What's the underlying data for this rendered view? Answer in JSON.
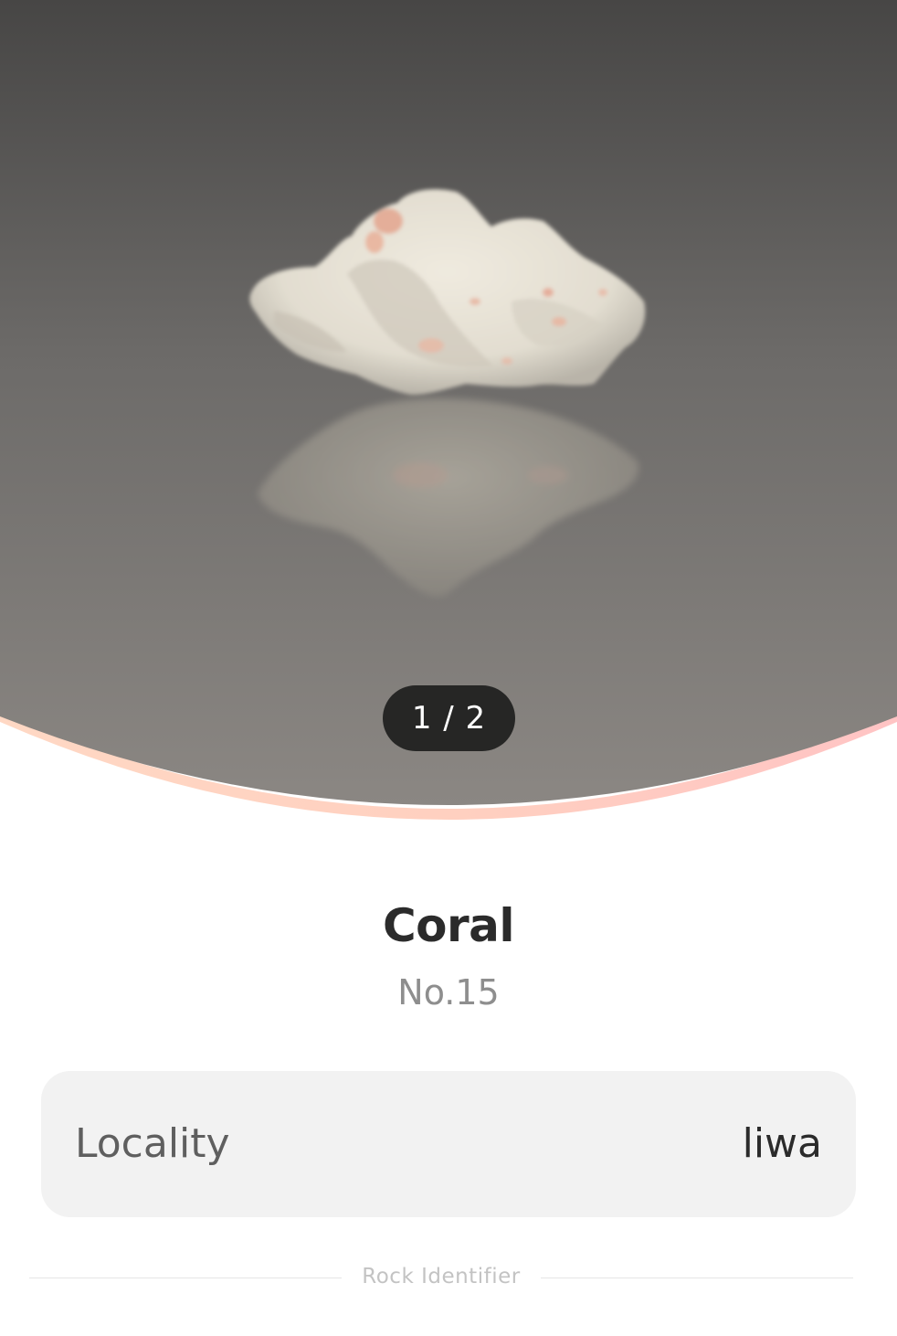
{
  "carousel": {
    "counter": "1 / 2",
    "image_subject": "coral-rock-specimen"
  },
  "specimen": {
    "name": "Coral",
    "number": "No.15"
  },
  "details": [
    {
      "label": "Locality",
      "value": "liwa"
    }
  ],
  "footer": {
    "watermark": "Rock Identifier"
  },
  "colors": {
    "hero_top": "#4a4948",
    "hero_bottom": "#888480",
    "accent_curve_left": "#ffd4c0",
    "accent_curve_right": "#ffc8c8",
    "counter_bg": "#262625",
    "card_bg": "#f2f2f2"
  }
}
